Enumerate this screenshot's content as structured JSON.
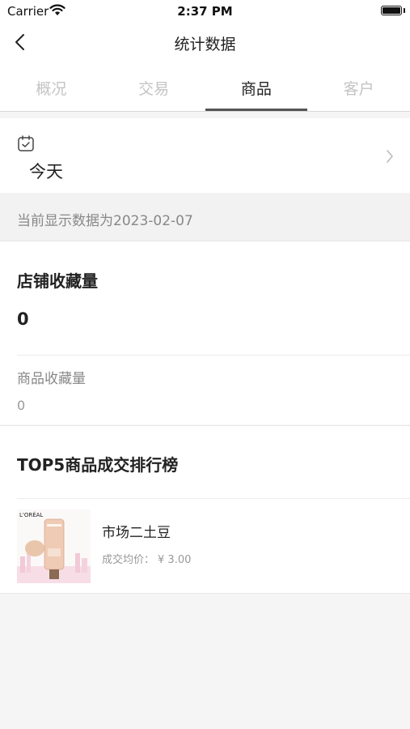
{
  "status_bar": {
    "carrier": "Carrier",
    "time": "2:37 PM"
  },
  "nav": {
    "title": "统计数据"
  },
  "tabs": [
    {
      "label": "概况",
      "active": false
    },
    {
      "label": "交易",
      "active": false
    },
    {
      "label": "商品",
      "active": true
    },
    {
      "label": "客户",
      "active": false
    }
  ],
  "date_filter": {
    "label": "今天",
    "icon": "calendar-icon"
  },
  "notice": "当前显示数据为2023-02-07",
  "stats": {
    "shop_favorites_label": "店铺收藏量",
    "shop_favorites_value": "0",
    "goods_favorites_label": "商品收藏量",
    "goods_favorites_value": "0"
  },
  "ranking": {
    "title": "TOP5商品成交排行榜",
    "items": [
      {
        "name": "市场二土豆",
        "price_label": "成交均价：",
        "price": "¥ 3.00",
        "brand_text": "L'ORÉAL"
      }
    ]
  },
  "colors": {
    "tab_active": "#222222",
    "tab_inactive": "#c4c4c4",
    "accent_underline": "#555555"
  }
}
